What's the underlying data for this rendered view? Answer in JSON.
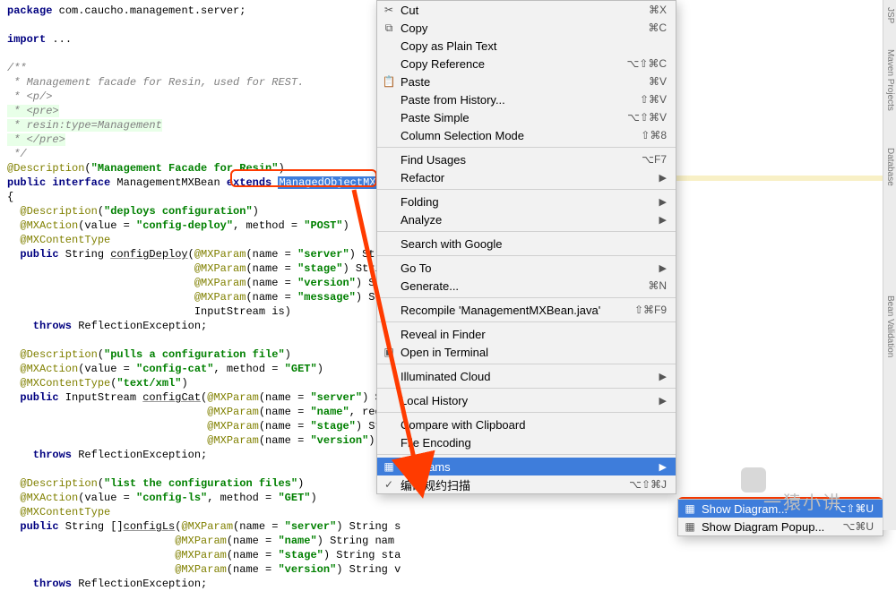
{
  "code": {
    "l1a": "package",
    "l1b": " com.caucho.management.server;",
    "l3a": "import",
    "l3b": " ...",
    "c1": "/**",
    "c2": " * Management facade for Resin, used for REST.",
    "c3": " * <p/>",
    "c4": " * <pre>",
    "c5": " * resin:type=Management",
    "c6": " * </pre>",
    "c7": " */",
    "d1a": "@Description",
    "d1b": "(",
    "d1c": "\"Management Facade for Resin\"",
    "d1d": ")",
    "d2a": "public interface",
    "d2b": " ManagementMXBean ",
    "d2c": "extends",
    "d2d": " ",
    "d2e": "ManagedObjectMXBean",
    "brace_o": "{",
    "a1a": "  @Description",
    "a1b": "(",
    "a1c": "\"deploys configuration\"",
    "a1d": ")",
    "a2a": "  @MXAction",
    "a2b": "(value = ",
    "a2c": "\"config-deploy\"",
    "a2d": ", method = ",
    "a2e": "\"POST\"",
    "a2f": ")",
    "a3": "  @MXContentType",
    "m1a": "  public",
    "m1b": " String ",
    "m1c": "configDeploy",
    "m1d": "(",
    "m1e": "@MXParam",
    "m1f": "(name = ",
    "m1g": "\"server\"",
    "m1h": ") String",
    "p2a": "                             @MXParam",
    "p2b": "(name = ",
    "p2c": "\"stage\"",
    "p2d": ") String",
    "p3a": "                             @MXParam",
    "p3b": "(name = ",
    "p3c": "\"version\"",
    "p3d": ") St",
    "p4a": "                             @MXParam",
    "p4b": "(name = ",
    "p4c": "\"message\"",
    "p4d": ") St",
    "p5": "                             InputStream is)",
    "th1a": "    throws",
    "th1b": " ReflectionException;",
    "b1a": "  @Description",
    "b1b": "(",
    "b1c": "\"pulls a configuration file\"",
    "b1d": ")",
    "b2a": "  @MXAction",
    "b2b": "(value = ",
    "b2c": "\"config-cat\"",
    "b2d": ", method = ",
    "b2e": "\"GET\"",
    "b2f": ")",
    "b3a": "  @MXContentType",
    "b3b": "(",
    "b3c": "\"text/xml\"",
    "b3d": ")",
    "m2a": "  public",
    "m2b": " InputStream ",
    "m2c": "configCat",
    "m2d": "(",
    "m2e": "@MXParam",
    "m2f": "(name = ",
    "m2g": "\"server\"",
    "m2h": ") Stri",
    "q2a": "                               @MXParam",
    "q2b": "(name = ",
    "q2c": "\"name\"",
    "q2d": ", required =",
    "q3a": "                               @MXParam",
    "q3b": "(name = ",
    "q3c": "\"stage\"",
    "q3d": ") String sta",
    "q4a": "                               @MXParam",
    "q4b": "(name = ",
    "q4c": "\"version\"",
    "q4d": ") String v",
    "th2a": "    throws",
    "th2b": " ReflectionException;",
    "e1a": "  @Description",
    "e1b": "(",
    "e1c": "\"list the configuration files\"",
    "e1d": ")",
    "e2a": "  @MXAction",
    "e2b": "(value = ",
    "e2c": "\"config-ls\"",
    "e2d": ", method = ",
    "e2e": "\"GET\"",
    "e2f": ")",
    "e3": "  @MXContentType",
    "m3a": "  public",
    "m3b": " String []",
    "m3c": "configLs",
    "m3d": "(",
    "m3e": "@MXParam",
    "m3f": "(name = ",
    "m3g": "\"server\"",
    "m3h": ") String s",
    "r2a": "                          @MXParam",
    "r2b": "(name = ",
    "r2c": "\"name\"",
    "r2d": ") String nam",
    "r3a": "                          @MXParam",
    "r3b": "(name = ",
    "r3c": "\"stage\"",
    "r3d": ") String sta",
    "r4a": "                          @MXParam",
    "r4b": "(name = ",
    "r4c": "\"version\"",
    "r4d": ") String v",
    "th3a": "    throws",
    "th3b": " ReflectionException;"
  },
  "menu": {
    "items": [
      {
        "icon": "✂",
        "label": "Cut",
        "sc": "⌘X"
      },
      {
        "icon": "⧉",
        "label": "Copy",
        "sc": "⌘C"
      },
      {
        "icon": "",
        "label": "Copy as Plain Text",
        "sc": ""
      },
      {
        "icon": "",
        "label": "Copy Reference",
        "sc": "⌥⇧⌘C"
      },
      {
        "icon": "📋",
        "label": "Paste",
        "sc": "⌘V"
      },
      {
        "icon": "",
        "label": "Paste from History...",
        "sc": "⇧⌘V"
      },
      {
        "icon": "",
        "label": "Paste Simple",
        "sc": "⌥⇧⌘V"
      },
      {
        "icon": "",
        "label": "Column Selection Mode",
        "sc": "⇧⌘8"
      }
    ],
    "items2": [
      {
        "icon": "",
        "label": "Find Usages",
        "sc": "⌥F7"
      },
      {
        "icon": "",
        "label": "Refactor",
        "sc": "",
        "sub": true
      }
    ],
    "items3": [
      {
        "icon": "",
        "label": "Folding",
        "sc": "",
        "sub": true
      },
      {
        "icon": "",
        "label": "Analyze",
        "sc": "",
        "sub": true
      }
    ],
    "items4": [
      {
        "icon": "",
        "label": "Search with Google",
        "sc": ""
      }
    ],
    "items5": [
      {
        "icon": "",
        "label": "Go To",
        "sc": "",
        "sub": true
      },
      {
        "icon": "",
        "label": "Generate...",
        "sc": "⌘N"
      }
    ],
    "items6": [
      {
        "icon": "",
        "label": "Recompile 'ManagementMXBean.java'",
        "sc": "⇧⌘F9"
      }
    ],
    "items7": [
      {
        "icon": "",
        "label": "Reveal in Finder",
        "sc": ""
      },
      {
        "icon": "▣",
        "label": "Open in Terminal",
        "sc": ""
      }
    ],
    "items8": [
      {
        "icon": "",
        "label": "Illuminated Cloud",
        "sc": "",
        "sub": true
      }
    ],
    "items9": [
      {
        "icon": "",
        "label": "Local History",
        "sc": "",
        "sub": true
      }
    ],
    "items10": [
      {
        "icon": "",
        "label": "Compare with Clipboard",
        "sc": ""
      },
      {
        "icon": "",
        "label": "File Encoding",
        "sc": ""
      }
    ],
    "items11": [
      {
        "icon": "▦",
        "label": "Diagrams",
        "sc": "",
        "sub": true,
        "hi": true
      },
      {
        "icon": "✓",
        "label": "编码规约扫描",
        "sc": "⌥⇧⌘J"
      }
    ]
  },
  "submenu": {
    "items": [
      {
        "icon": "▦",
        "label": "Show Diagram...",
        "sc": "⌥⇧⌘U",
        "hi": true
      },
      {
        "icon": "▦",
        "label": "Show Diagram Popup...",
        "sc": "⌥⌘U"
      }
    ]
  },
  "rail": {
    "t1": "JSP",
    "t2": "Maven Projects",
    "t3": "Database",
    "t4": "Bean Validation"
  },
  "watermark": "一猿小讲"
}
